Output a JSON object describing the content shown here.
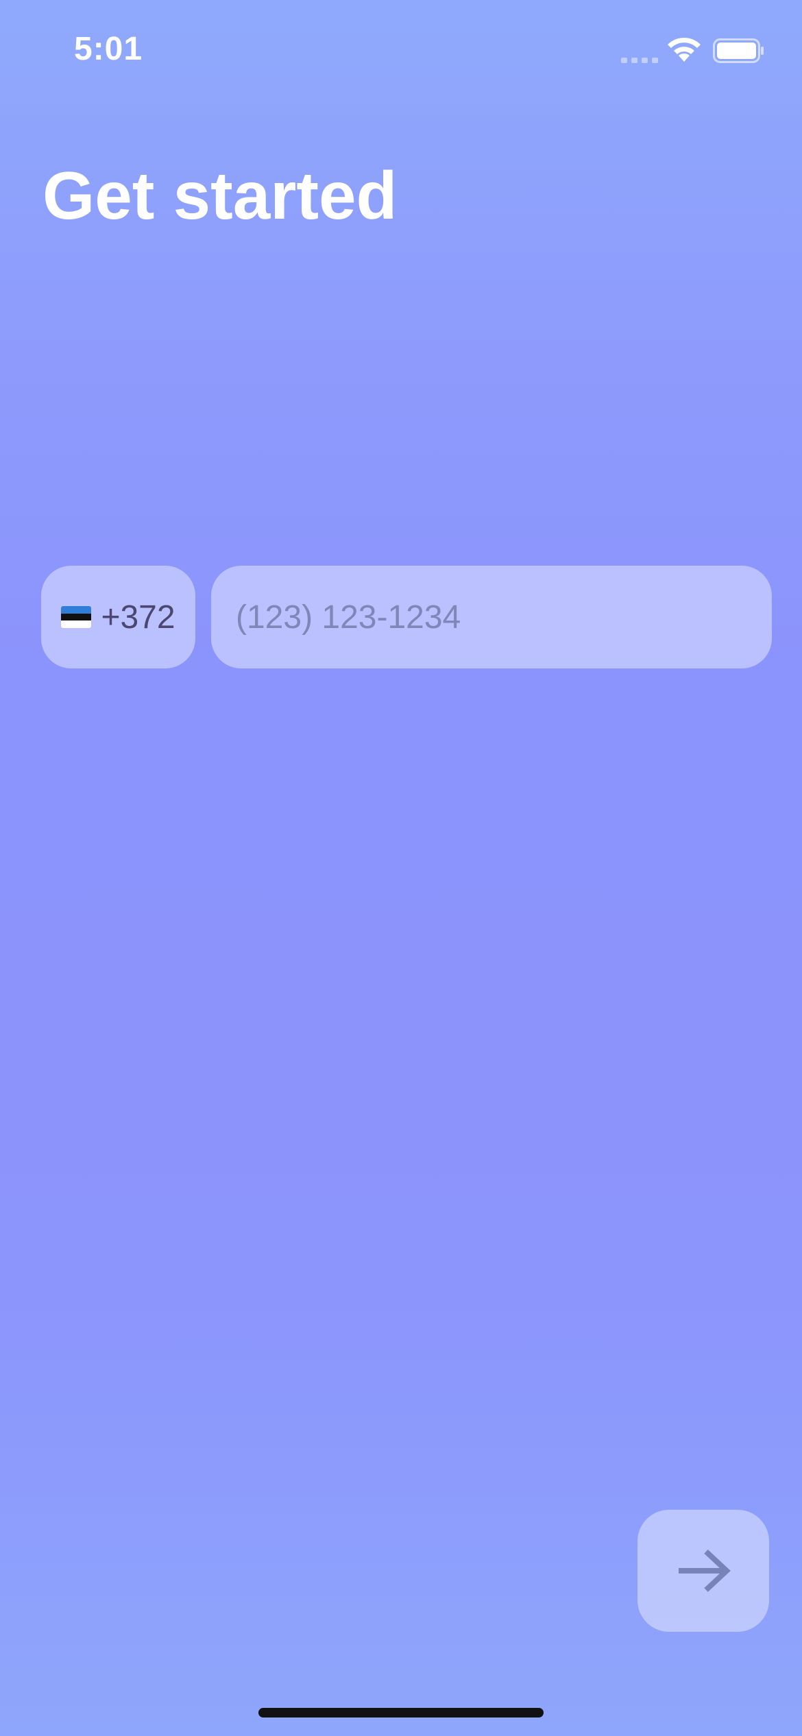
{
  "status_bar": {
    "time": "5:01"
  },
  "header": {
    "title": "Get started"
  },
  "phone_form": {
    "country_flag": "estonia-flag-icon",
    "dial_code": "+372",
    "phone_placeholder": "(123) 123-1234",
    "phone_value": ""
  },
  "actions": {
    "next_icon": "arrow-right-icon"
  },
  "colors": {
    "background_top": "#8faafc",
    "background_mid": "#8b93fc",
    "field_fill": "#dfe2ff",
    "placeholder": "#7f86b8",
    "dial_code_text": "#4c4770",
    "arrow": "#7a82ba"
  }
}
